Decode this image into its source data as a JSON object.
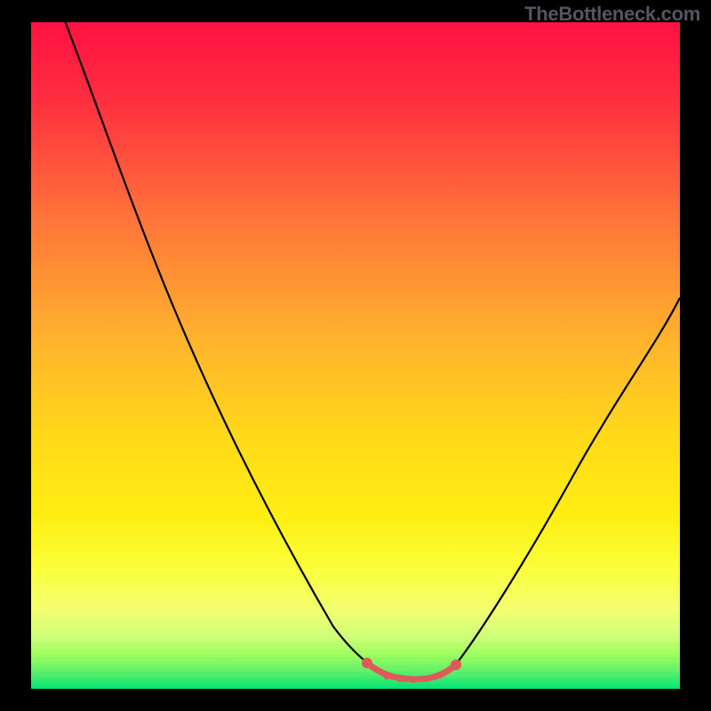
{
  "watermark": "TheBottleneck.com",
  "chart_data": {
    "type": "line",
    "title": "",
    "xlabel": "",
    "ylabel": "",
    "xlim": [
      0,
      100
    ],
    "ylim": [
      0,
      100
    ],
    "grid": false,
    "legend": false,
    "gradient_colors": {
      "top": "#ff1243",
      "upper_mid": "#ff8a2b",
      "mid": "#ffe100",
      "lower_mid": "#f7ff5a",
      "green_band_start": "#9cff5e",
      "bottom": "#00e676"
    },
    "series": [
      {
        "name": "black-curve",
        "color": "#000000",
        "x": [
          5,
          10,
          15,
          20,
          25,
          30,
          35,
          40,
          45,
          50,
          52,
          55,
          60,
          63,
          65,
          70,
          75,
          80,
          85,
          90,
          95,
          100
        ],
        "y": [
          100,
          89,
          78,
          67,
          56,
          45,
          35,
          26,
          17,
          9,
          5,
          2,
          1,
          1,
          2,
          7,
          15,
          24,
          33,
          43,
          53,
          60
        ]
      },
      {
        "name": "red-bottom-segment",
        "color": "#e05a5a",
        "x": [
          52,
          55,
          58,
          60,
          62,
          63,
          64,
          65,
          66
        ],
        "y": [
          4,
          2,
          1.5,
          1,
          1,
          1,
          1.5,
          2,
          3
        ]
      }
    ],
    "annotations": []
  }
}
